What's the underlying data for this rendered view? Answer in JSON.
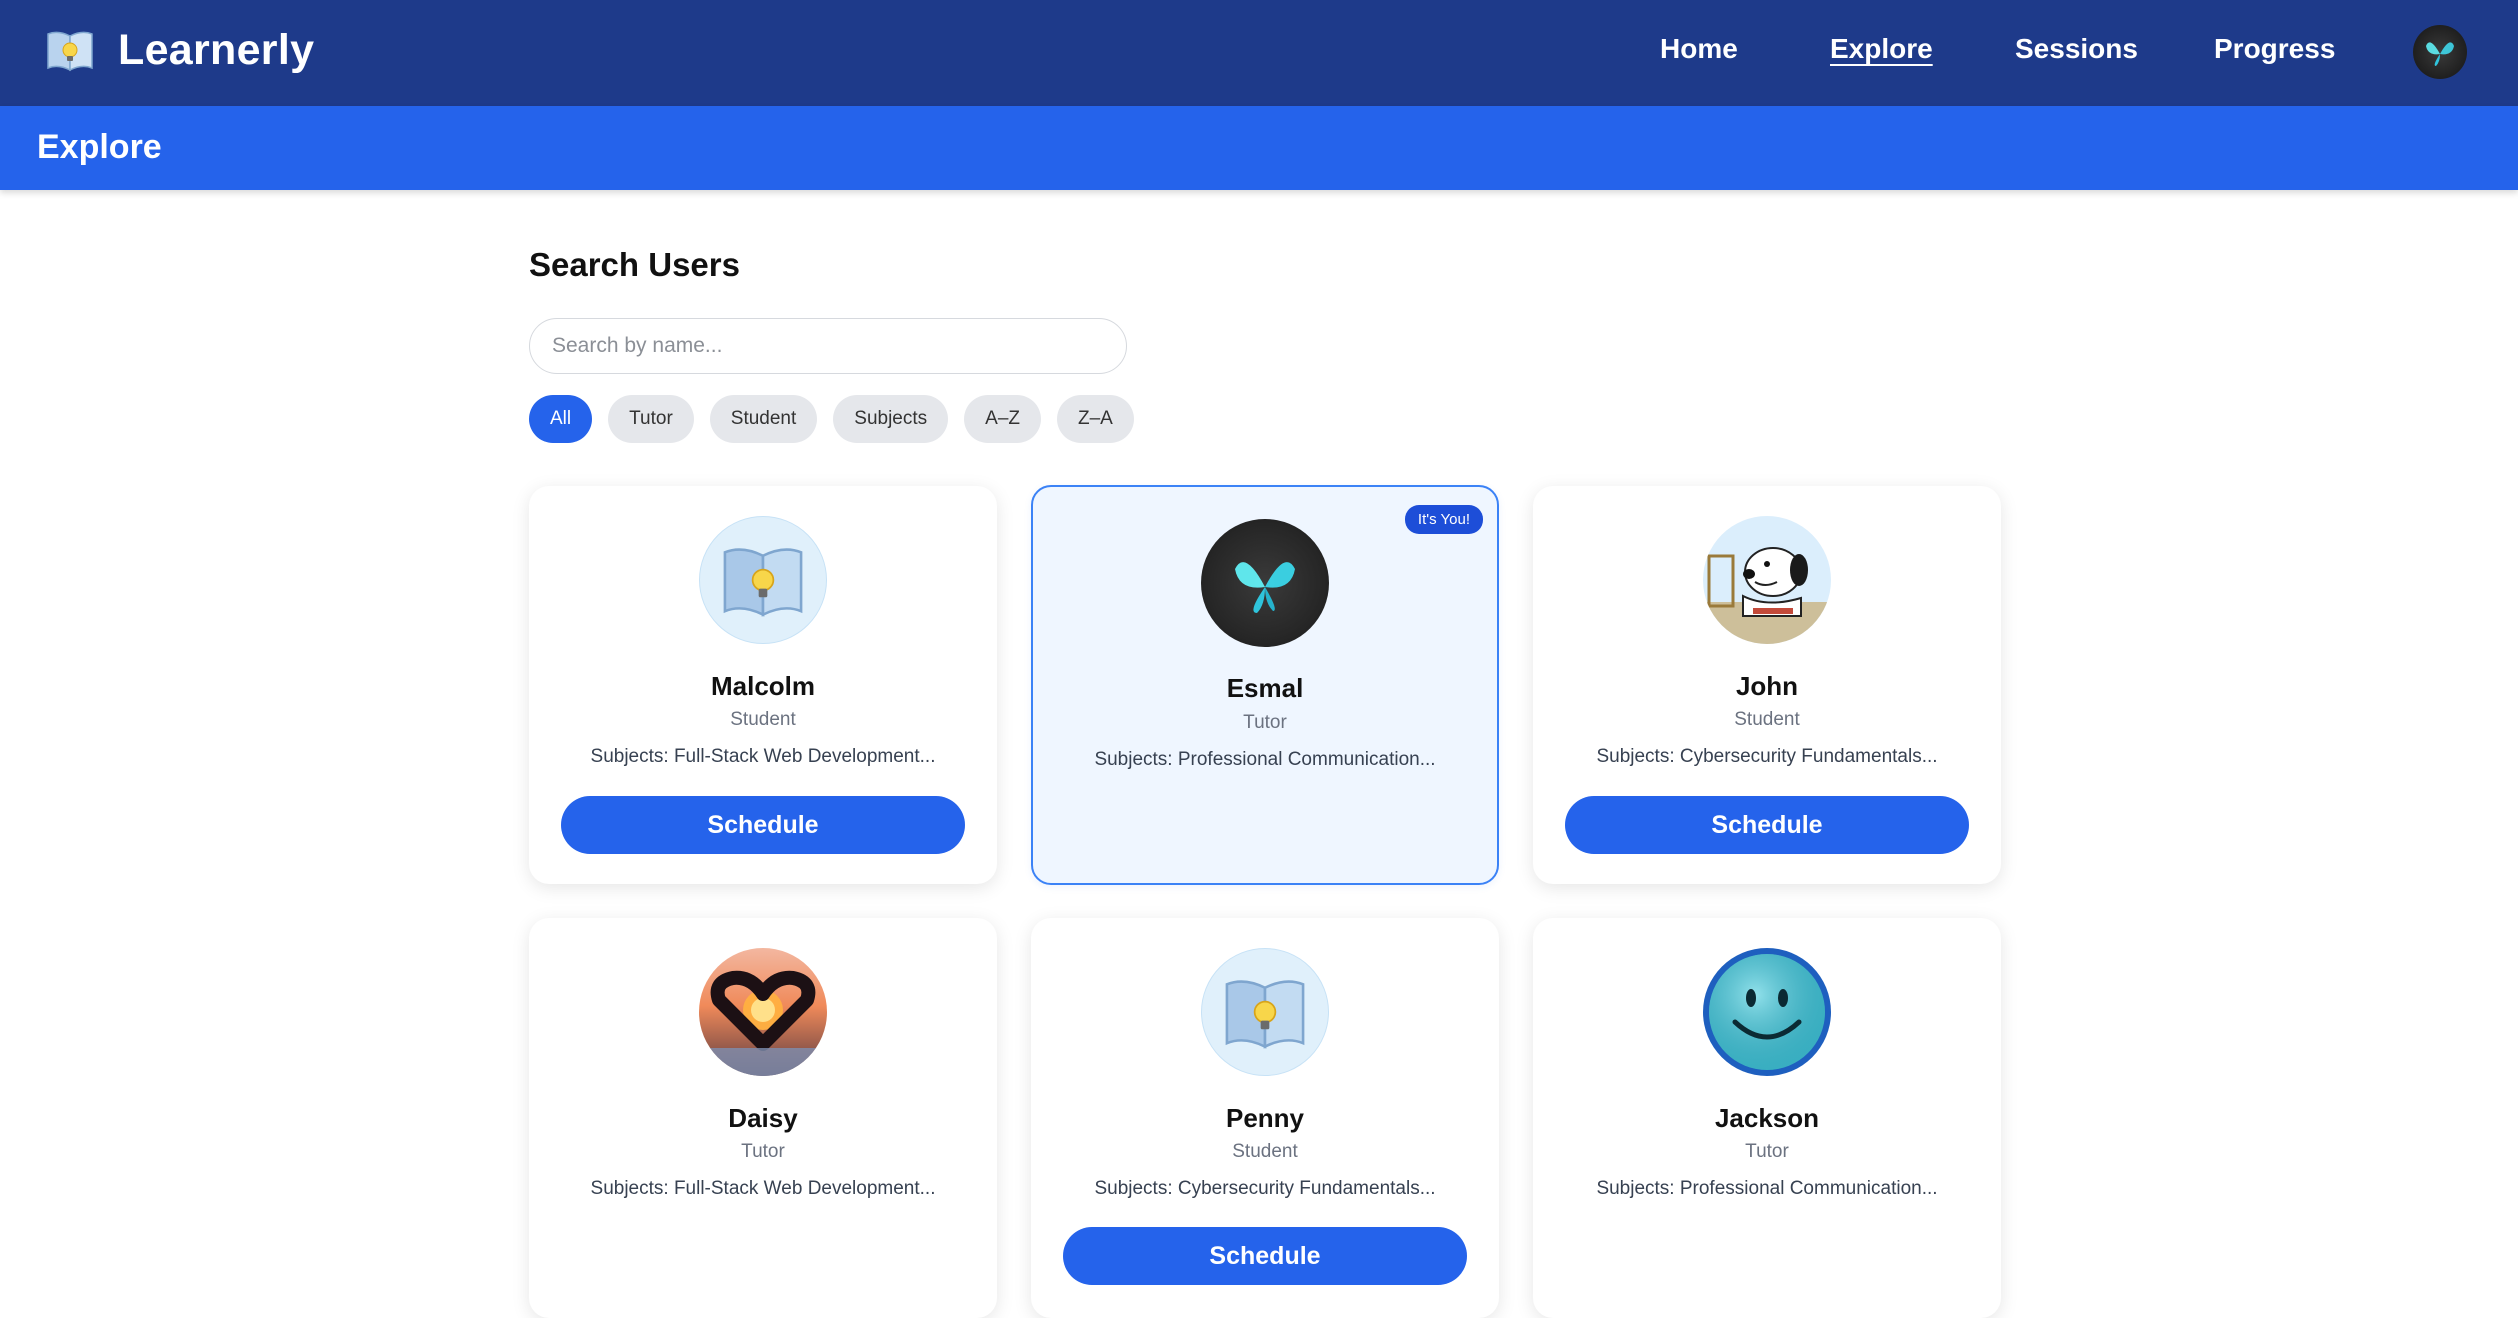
{
  "app": {
    "name": "Learnerly"
  },
  "nav": {
    "links": [
      {
        "label": "Home"
      },
      {
        "label": "Explore"
      },
      {
        "label": "Sessions"
      },
      {
        "label": "Progress"
      }
    ],
    "active": "Explore",
    "avatar_icon": "butterfly-icon"
  },
  "subheader": {
    "title": "Explore"
  },
  "search": {
    "title": "Search Users",
    "placeholder": "Search by name...",
    "value": ""
  },
  "filters": [
    {
      "label": "All",
      "active": true
    },
    {
      "label": "Tutor",
      "active": false
    },
    {
      "label": "Student",
      "active": false
    },
    {
      "label": "Subjects",
      "active": false
    },
    {
      "label": "A–Z",
      "active": false
    },
    {
      "label": "Z–A",
      "active": false
    }
  ],
  "cards": [
    {
      "name": "Malcolm",
      "role": "Student",
      "subjects": "Subjects: Full-Stack Web Development...",
      "button": "Schedule",
      "avatar": "book-lightbulb-icon"
    },
    {
      "name": "Esmal",
      "role": "Tutor",
      "subjects": "Subjects: Professional Communication...",
      "badge": "It's You!",
      "avatar": "butterfly-icon"
    },
    {
      "name": "John",
      "role": "Student",
      "subjects": "Subjects: Cybersecurity Fundamentals...",
      "button": "Schedule",
      "avatar": "dog-cartoon-icon"
    },
    {
      "name": "Daisy",
      "role": "Tutor",
      "subjects": "Subjects: Full-Stack Web Development...",
      "avatar": "heart-hands-sunset-icon"
    },
    {
      "name": "Penny",
      "role": "Student",
      "subjects": "Subjects: Cybersecurity Fundamentals...",
      "button": "Schedule",
      "avatar": "book-lightbulb-icon"
    },
    {
      "name": "Jackson",
      "role": "Tutor",
      "subjects": "Subjects: Professional Communication...",
      "avatar": "smiley-face-icon"
    }
  ],
  "colors": {
    "navbar": "#1e3a8a",
    "subheader": "#2563eb",
    "accent": "#2563eb",
    "chip_bg": "#e5e7eb"
  }
}
